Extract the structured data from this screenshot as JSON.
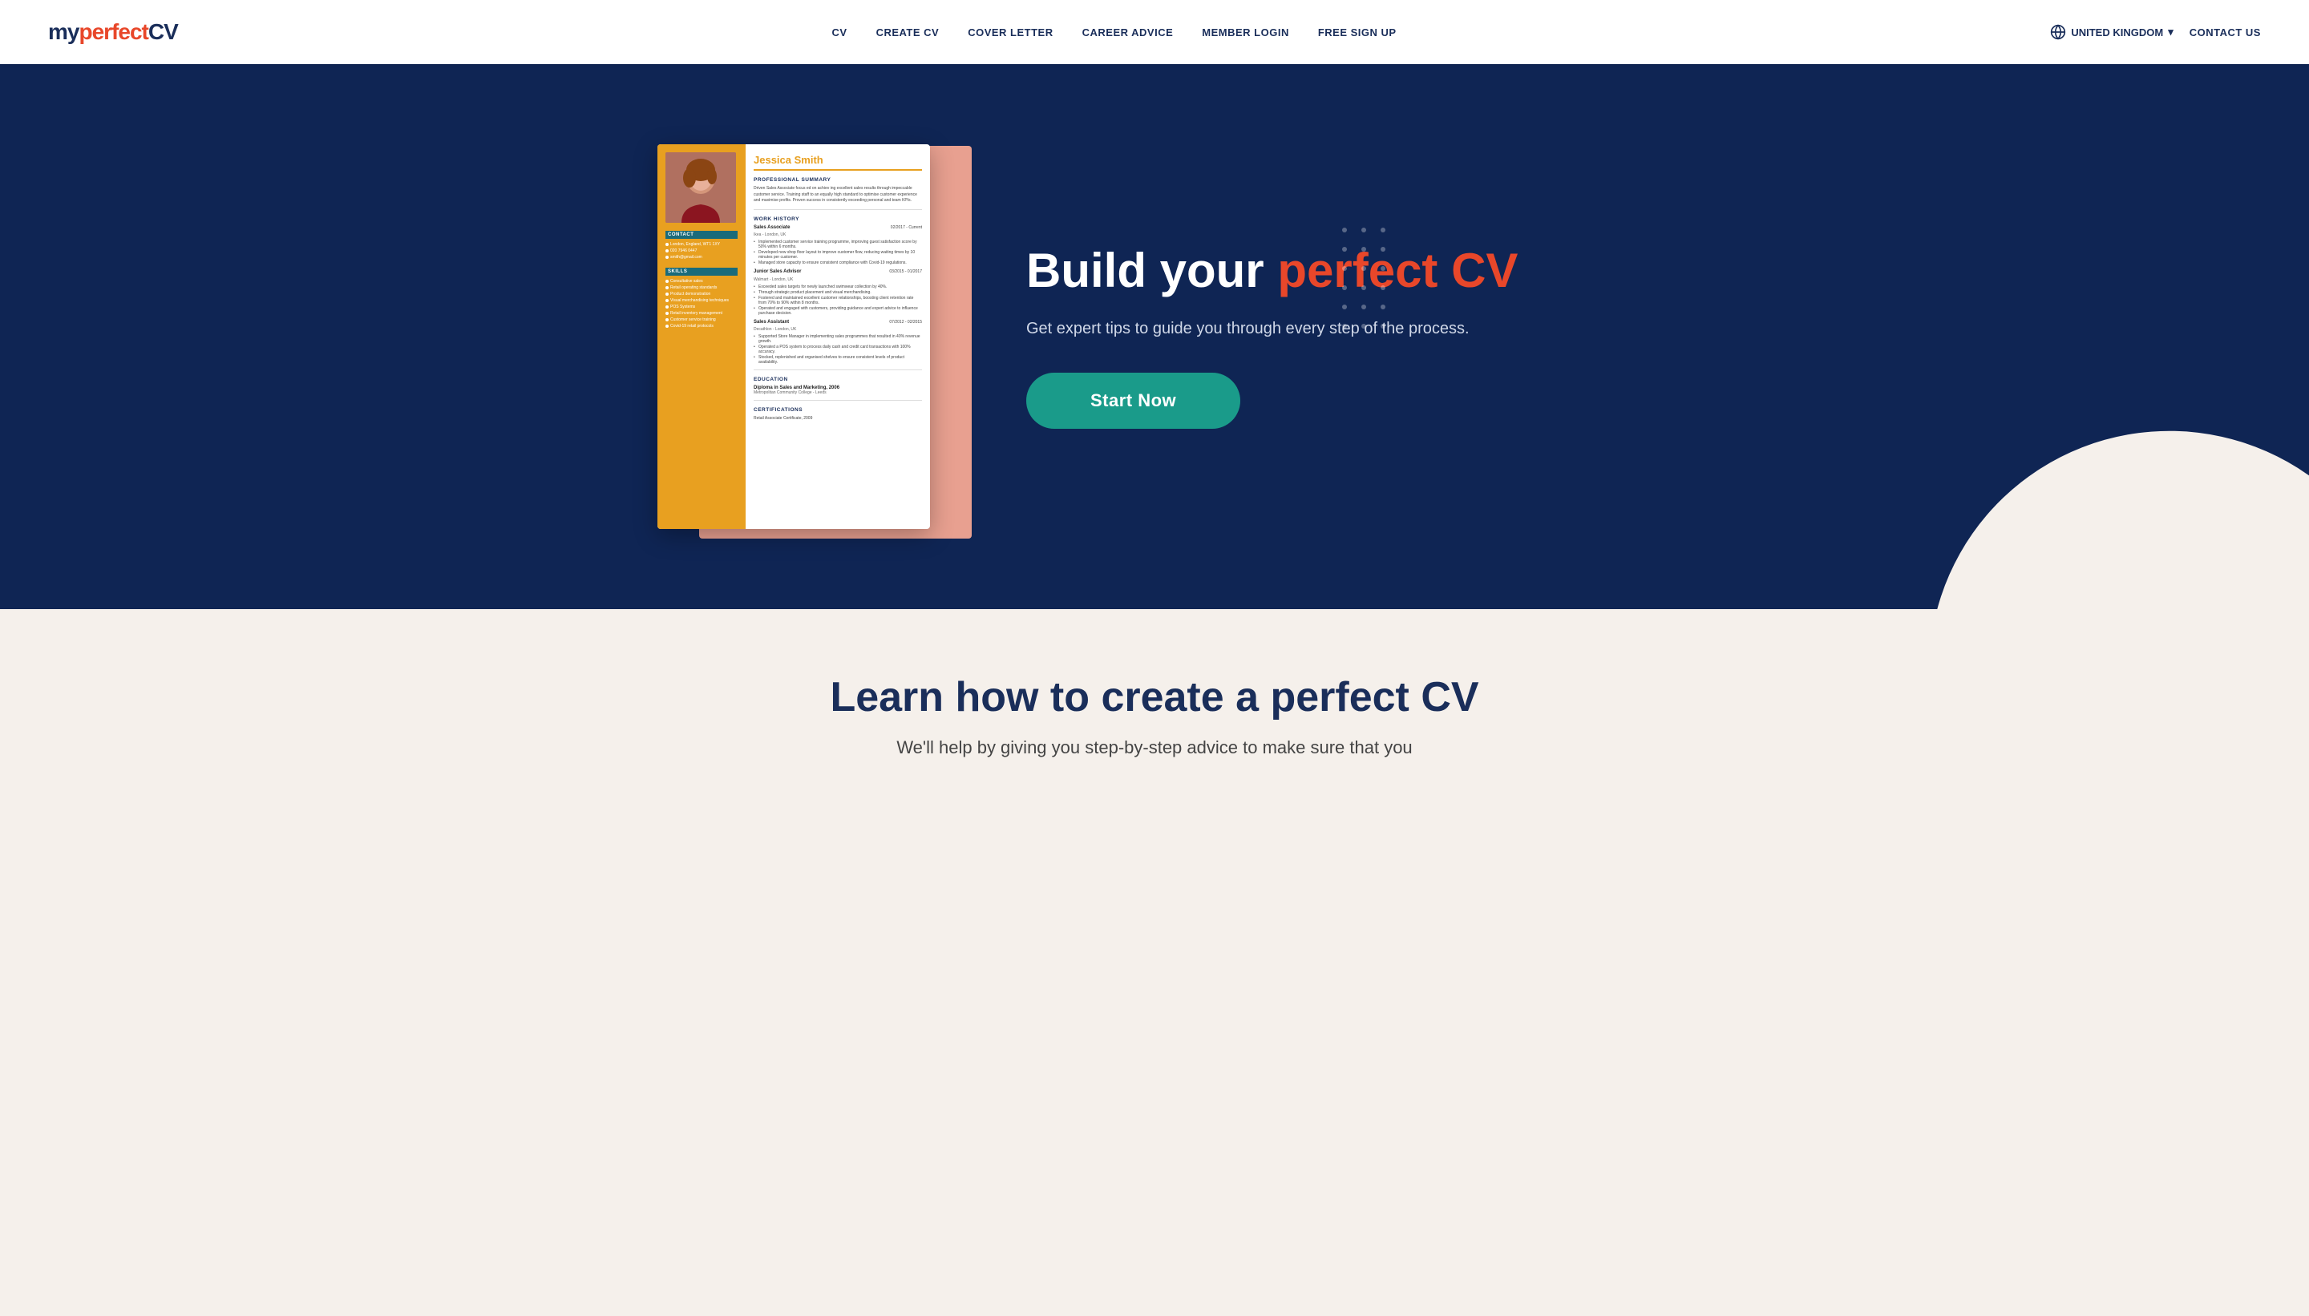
{
  "header": {
    "logo": {
      "my": "my",
      "perfect": "perfect",
      "cv": "CV"
    },
    "nav": [
      {
        "id": "cv",
        "label": "CV"
      },
      {
        "id": "create-cv",
        "label": "CREATE CV"
      },
      {
        "id": "cover-letter",
        "label": "COVER LETTER"
      },
      {
        "id": "career-advice",
        "label": "CAREER ADVICE"
      },
      {
        "id": "member-login",
        "label": "MEMBER LOGIN"
      },
      {
        "id": "free-sign-up",
        "label": "FREE SIGN UP"
      }
    ],
    "region": {
      "label": "UNITED KINGDOM",
      "caret": "▾"
    },
    "contact_us": "CONTACT US"
  },
  "hero": {
    "headline_part1": "Build your ",
    "headline_part2": "perfect CV",
    "subtext": "Get expert tips to guide you through every step of the process.",
    "cta_button": "Start Now"
  },
  "cv_preview": {
    "name": "Jessica Smith",
    "sections": {
      "professional_summary": {
        "title": "PROFESSIONAL SUMMARY",
        "text": "Driven Sales Associate focus ed on achiev ing excellent sales results through impeccable customer service. Training staff to an equally high standard to optimise customer experience and maximise profits. Proven success in consistently exceeding personal and team KPIs."
      },
      "work_history": {
        "title": "WORK HISTORY",
        "jobs": [
          {
            "title": "Sales Associate",
            "date": "02/2017 - Current",
            "company": "Ikea - London, UK",
            "bullets": [
              "Implemented customer service training programme, improving guest satisfaction score by 50% within 6 months.",
              "Developed new shop floor layout to improve customer flow, reducing waiting times by 10 minutes per customer.",
              "Managed store capacity to ensure consistent compliance with Covid-19 regulations."
            ]
          },
          {
            "title": "Junior Sales Advisor",
            "date": "03/2015 - 01/2017",
            "company": "Walmart - London, UK",
            "bullets": [
              "Exceeded sales targets for newly launched swimwear collection by 40%.",
              "Through strategic product placement and visual merchandising.",
              "Fostered and maintained excellent customer relationships, boosting client retention rate from 70% to 90% within 8 months.",
              "Operated and engaged with customers, providing guidance and expert advice to influence purchase decision."
            ]
          },
          {
            "title": "Sales Assistant",
            "date": "07/2012 - 02/2015",
            "company": "Decathlon - London, UK",
            "bullets": [
              "Supported Store Manager in implementing sales programmes that resulted in 40% revenue growth.",
              "Operated a POS system to process daily cash and credit card transactions with 100% accuracy.",
              "Stocked, replenished and organised shelves to ensure consistent levels of product availability."
            ]
          }
        ]
      },
      "education": {
        "title": "EDUCATION",
        "entries": [
          {
            "degree": "Diploma in Sales and Marketing, 2006",
            "school": "Metropolitan Community College - Leeds"
          }
        ]
      },
      "certifications": {
        "title": "CERTIFICATIONS",
        "items": [
          "Retail Associate Certificate, 2009"
        ]
      }
    },
    "sidebar": {
      "contact": {
        "title": "CONTACT",
        "items": [
          "London, England, WT1 1XY",
          "020 7946 0447",
          "smith@gmail.com"
        ]
      },
      "skills": {
        "title": "SKILLS",
        "items": [
          "Consultative sales",
          "Retail operating standards",
          "Product demonstration",
          "Visual merchandising techniques",
          "POS Systems",
          "Retail inventory management",
          "Customer service training",
          "Covid-19 retail protocols"
        ]
      }
    }
  },
  "bottom_section": {
    "title": "Learn how to create a perfect CV",
    "subtitle": "We'll help by giving you step-by-step advice to make sure that you"
  }
}
